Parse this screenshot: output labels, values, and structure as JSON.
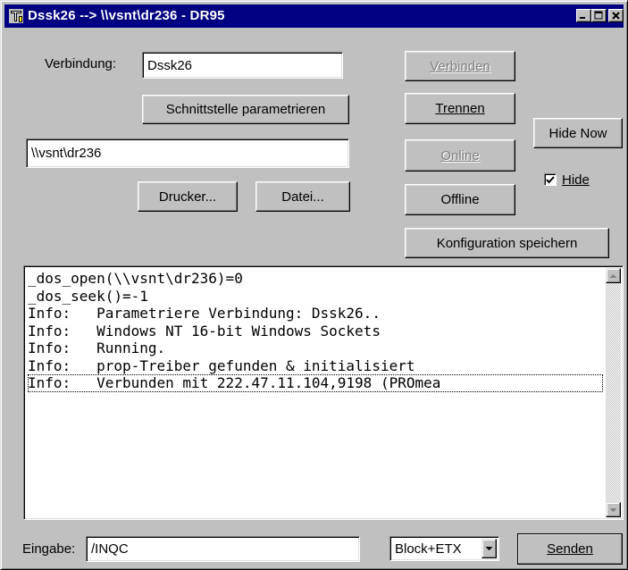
{
  "window": {
    "title": "Dssk26 --> \\\\vsnt\\dr236 - DR95",
    "icon": "app-icon",
    "controls": {
      "minimize": "_",
      "maximize": "□",
      "close": "×"
    }
  },
  "connection": {
    "label": "Verbindung:",
    "value": "Dssk26",
    "parametrize_button": "Schnittstelle parametrieren",
    "path_value": "\\\\vsnt\\dr236"
  },
  "buttons": {
    "verbinden": "Verbinden",
    "trennen": "Trennen",
    "online": "Online",
    "offline": "Offline",
    "hide_now": "Hide Now",
    "drucker": "Drucker...",
    "datei": "Datei...",
    "save_config": "Konfiguration speichern",
    "senden": "Senden"
  },
  "hide_checkbox": {
    "label": "Hide",
    "checked": true
  },
  "log": {
    "lines": [
      "_dos_open(\\\\vsnt\\dr236)=0",
      "_dos_seek()=-1",
      "Info:   Parametriere Verbindung: Dssk26..",
      "Info:   Windows NT 16-bit Windows Sockets",
      "Info:   Running.",
      "Info:   prop-Treiber gefunden & initialisiert",
      "Info:   Verbunden mit 222.47.11.104,9198 (PROmea"
    ],
    "focused_line": 6
  },
  "input": {
    "label": "Eingabe:",
    "value": "/INQC",
    "mode_selected": "Block+ETX"
  }
}
